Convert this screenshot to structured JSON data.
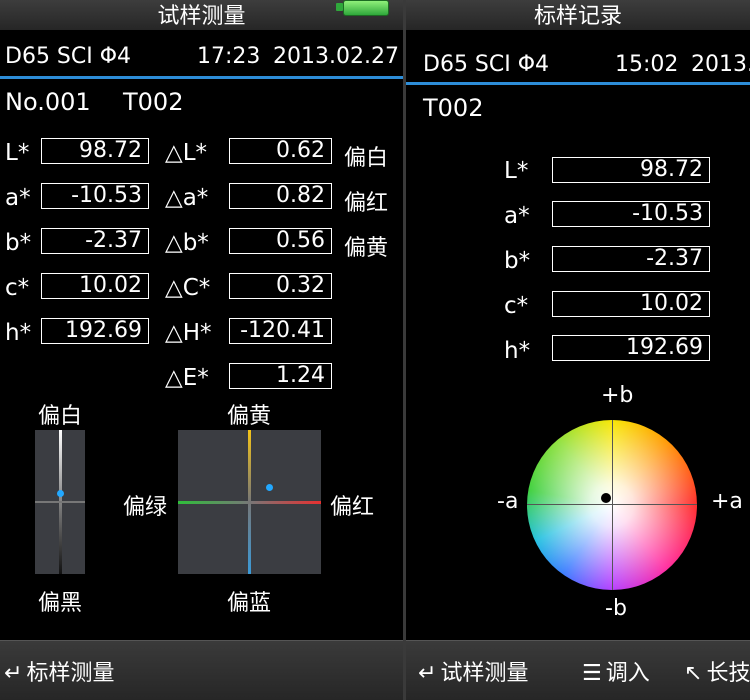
{
  "left": {
    "title": "试样测量",
    "info": {
      "illum": "D65 SCI Φ4",
      "time": "17:23",
      "date": "2013.02.27"
    },
    "sample": {
      "no": "No.001",
      "name": "T002"
    },
    "values": [
      {
        "label": "L*",
        "value": "98.72"
      },
      {
        "label": "a*",
        "value": "-10.53"
      },
      {
        "label": "b*",
        "value": "-2.37"
      },
      {
        "label": "c*",
        "value": "10.02"
      },
      {
        "label": "h*",
        "value": "192.69"
      }
    ],
    "deltas": [
      {
        "label": "△L*",
        "value": "0.62",
        "note": "偏白"
      },
      {
        "label": "△a*",
        "value": "0.82",
        "note": "偏红"
      },
      {
        "label": "△b*",
        "value": "0.56",
        "note": "偏黄"
      },
      {
        "label": "△C*",
        "value": "0.32",
        "note": ""
      },
      {
        "label": "△H*",
        "value": "-120.41",
        "note": ""
      },
      {
        "label": "△E*",
        "value": "1.24",
        "note": ""
      }
    ],
    "lightbar": {
      "top": "偏白",
      "bottom": "偏黑"
    },
    "abgrid": {
      "top": "偏黄",
      "bottom": "偏蓝",
      "left": "偏绿",
      "right": "偏红"
    },
    "bottom": {
      "item1": "标样测量"
    },
    "colors": {
      "accent": "#2d8dd8",
      "dot": "#22a8ff"
    }
  },
  "right": {
    "title": "标样记录",
    "info": {
      "illum": "D65 SCI Φ4",
      "time": "15:02",
      "date": "2013."
    },
    "sample": {
      "name": "T002"
    },
    "values": [
      {
        "label": "L*",
        "value": "98.72"
      },
      {
        "label": "a*",
        "value": "-10.53"
      },
      {
        "label": "b*",
        "value": "-2.37"
      },
      {
        "label": "c*",
        "value": "10.02"
      },
      {
        "label": "h*",
        "value": "192.69"
      }
    ],
    "wheel": {
      "top": "+b",
      "bottom": "-b",
      "left": "-a",
      "right": "+a"
    },
    "bottom": {
      "item1": "试样测量",
      "item2": "调入",
      "item3": "长技"
    }
  },
  "icons": {
    "enter": "enter-arrow-icon",
    "menu": "menu-lines-icon",
    "diag": "diagonal-arrow-icon",
    "battery": "battery-icon"
  }
}
